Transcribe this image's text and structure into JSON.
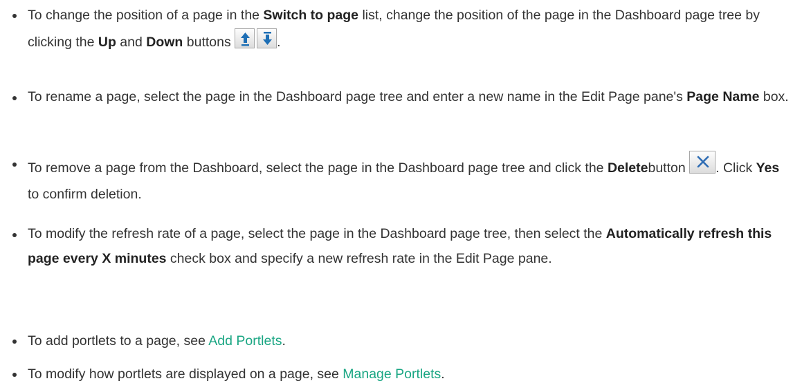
{
  "items": [
    {
      "t1": "To change the position of a page in the ",
      "b1": "Switch to page",
      "t2": " list, change the position of the page in the Dashboard page tree by clicking the ",
      "b2": "Up",
      "t3": " and ",
      "b3": "Down",
      "t4": " buttons ",
      "t5": "."
    },
    {
      "t1": "To rename a page, select the page in the Dashboard page tree and enter a new name in the Edit Page pane's ",
      "b1": "Page Name",
      "t2": " box."
    },
    {
      "t1": "To remove a page from the Dashboard, select the page in the Dashboard page tree and click the ",
      "b1": "Delete",
      "t2": "button ",
      "t3": ". Click ",
      "b2": "Yes",
      "t4": " to confirm deletion."
    },
    {
      "t1": "To modify the refresh rate of a page, select the page in the Dashboard page tree, then select the ",
      "b1": "Automatically refresh this page every X minutes",
      "t2": " check box and specify a new refresh rate in the Edit Page pane."
    },
    {
      "t1": "To add portlets to a page, see ",
      "link": "Add Portlets",
      "t2": "."
    },
    {
      "t1": "To modify how portlets are displayed on a page, see ",
      "link": "Manage Portlets",
      "t2": "."
    }
  ],
  "icons": {
    "up": "up-arrow-icon",
    "down": "down-arrow-icon",
    "delete": "delete-x-icon"
  },
  "colors": {
    "text": "#333333",
    "link": "#1aa683",
    "arrow": "#1e6fb5",
    "delete_x": "#2f6db4"
  }
}
